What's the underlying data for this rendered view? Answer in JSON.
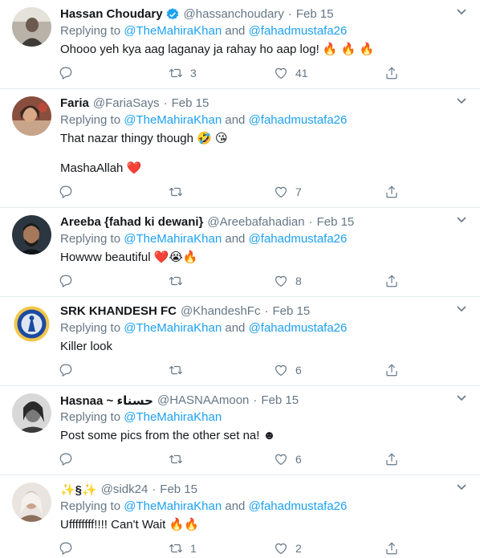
{
  "replying_label": "Replying to",
  "and_label": "and",
  "tweets": [
    {
      "name": "Hassan Choudary",
      "verified": true,
      "handle": "@hassanchoudary",
      "date": "Feb 15",
      "mentions": [
        "@TheMahiraKhan",
        "@fahadmustafa26"
      ],
      "text_lines": [
        "Ohooo yeh kya aag laganay ja rahay ho aap log! 🔥 🔥 🔥"
      ],
      "replies": "",
      "retweets": "3",
      "likes": "41"
    },
    {
      "name": "Faria",
      "verified": false,
      "handle": "@FariaSays",
      "date": "Feb 15",
      "mentions": [
        "@TheMahiraKhan",
        "@fahadmustafa26"
      ],
      "text_lines": [
        "That nazar thingy though 🤣 😘",
        "",
        "MashaAllah ❤️"
      ],
      "replies": "",
      "retweets": "",
      "likes": "7"
    },
    {
      "name": "Areeba {fahad ki dewani}",
      "verified": false,
      "handle": "@Areebafahadian",
      "date": "Feb 15",
      "mentions": [
        "@TheMahiraKhan",
        "@fahadmustafa26"
      ],
      "text_lines": [
        "Howww beautiful ❤️😭🔥"
      ],
      "replies": "",
      "retweets": "",
      "likes": "8"
    },
    {
      "name": "SRK KHANDESH FC",
      "verified": false,
      "handle": "@KhandeshFc",
      "date": "Feb 15",
      "mentions": [
        "@TheMahiraKhan",
        "@fahadmustafa26"
      ],
      "text_lines": [
        "Killer look"
      ],
      "replies": "",
      "retweets": "",
      "likes": "6"
    },
    {
      "name": "Hasnaa ~ حسناء",
      "verified": false,
      "handle": "@HASNAAmoon",
      "date": "Feb 15",
      "mentions": [
        "@TheMahiraKhan"
      ],
      "text_lines": [
        "Post some pics from the other set na! ☻"
      ],
      "replies": "",
      "retweets": "",
      "likes": "6"
    },
    {
      "name": "✨§✨",
      "verified": false,
      "handle": "@sidk24",
      "date": "Feb 15",
      "mentions": [
        "@TheMahiraKhan",
        "@fahadmustafa26"
      ],
      "text_lines": [
        "Uffffffff!!!! Can't Wait 🔥🔥"
      ],
      "replies": "",
      "retweets": "1",
      "likes": "2"
    }
  ],
  "icons": {
    "reply": "reply-icon",
    "retweet": "retweet-icon",
    "like": "like-icon",
    "share": "share-icon",
    "more": "chevron-down-icon",
    "verified": "verified-badge-icon"
  },
  "colors": {
    "link": "#1da1f2",
    "muted": "#657786",
    "border": "#e6ecf0",
    "verified": "#1da1f2"
  }
}
